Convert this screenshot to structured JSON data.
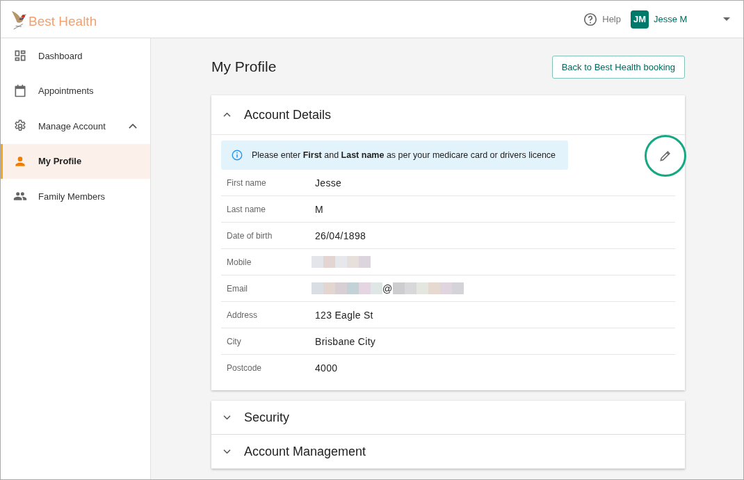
{
  "header": {
    "logo_text": "Best Health",
    "help": "Help",
    "user": {
      "initials": "JM",
      "name": "Jesse M"
    }
  },
  "sidebar": {
    "items": [
      {
        "label": "Dashboard",
        "kind": "dashboard",
        "selected": false
      },
      {
        "label": "Appointments",
        "kind": "calendar",
        "selected": false
      },
      {
        "label": "Manage Account",
        "kind": "settings",
        "selected": false,
        "expanded": true,
        "children": [
          {
            "label": "My Profile",
            "kind": "profile",
            "selected": true
          },
          {
            "label": "Family Members",
            "kind": "family",
            "selected": false
          }
        ]
      }
    ]
  },
  "page": {
    "title": "My Profile",
    "back_button": "Back to Best Health booking"
  },
  "panels": [
    {
      "title": "Account Details",
      "expanded": true,
      "notice": "Please enter **First** and **Last name** as per your medicare card or drivers licence",
      "edit_button": {
        "highlighted": true
      },
      "fields": [
        {
          "label": "First name",
          "kind": "text",
          "value": "Jesse"
        },
        {
          "label": "Last name",
          "kind": "text",
          "value": "M"
        },
        {
          "label": "Date of birth",
          "kind": "text",
          "value": "26/04/1898"
        },
        {
          "label": "Mobile",
          "kind": "redacted"
        },
        {
          "label": "Email",
          "kind": "redacted_email",
          "value": "@"
        },
        {
          "label": "Address",
          "kind": "text",
          "value": "123 Eagle St"
        },
        {
          "label": "City",
          "kind": "text",
          "value": "Brisbane City"
        },
        {
          "label": "Postcode",
          "kind": "text",
          "value": "4000"
        }
      ]
    },
    {
      "title": "Security",
      "expanded": false
    },
    {
      "title": "Account Management",
      "expanded": false
    }
  ]
}
